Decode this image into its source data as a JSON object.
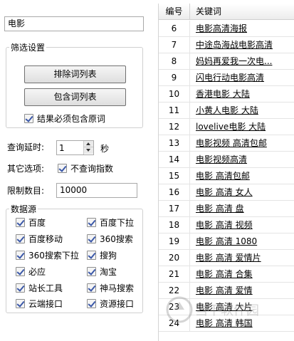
{
  "search": {
    "value": "电影"
  },
  "filter": {
    "legend": "筛选设置",
    "exclude_button": "排除词列表",
    "include_button": "包含词列表",
    "must_contain_label": "结果必须包含原词",
    "must_contain_checked": true
  },
  "query_delay": {
    "label": "查询延时:",
    "value": "1",
    "unit": "秒"
  },
  "other_options": {
    "label": "其它选项:",
    "no_index_label": "不查询指数",
    "no_index_checked": true
  },
  "limit": {
    "label": "限制数目:",
    "value": "10000"
  },
  "sources": {
    "legend": "数据源",
    "items": [
      {
        "label": "百度",
        "checked": true
      },
      {
        "label": "百度下拉",
        "checked": true
      },
      {
        "label": "百度移动",
        "checked": true
      },
      {
        "label": "360搜索",
        "checked": true
      },
      {
        "label": "360搜索下拉",
        "checked": true
      },
      {
        "label": "搜狗",
        "checked": true
      },
      {
        "label": "必应",
        "checked": true
      },
      {
        "label": "淘宝",
        "checked": true
      },
      {
        "label": "站长工具",
        "checked": true
      },
      {
        "label": "神马搜索",
        "checked": true
      },
      {
        "label": "云端接口",
        "checked": true
      },
      {
        "label": "资源接口",
        "checked": true
      }
    ]
  },
  "table": {
    "columns": [
      "编号",
      "关键词"
    ],
    "rows": [
      {
        "no": "6",
        "keyword": "电影高清海报"
      },
      {
        "no": "7",
        "keyword": "中途岛海战电影高清"
      },
      {
        "no": "8",
        "keyword": "妈妈再爱我一次电..."
      },
      {
        "no": "9",
        "keyword": "闪电行动电影高清"
      },
      {
        "no": "10",
        "keyword": "香港电影 大陆"
      },
      {
        "no": "11",
        "keyword": "小黄人电影 大陆"
      },
      {
        "no": "12",
        "keyword": "lovelive电影 大陆"
      },
      {
        "no": "13",
        "keyword": "电影视频 高清包邮"
      },
      {
        "no": "14",
        "keyword": "电影视频高清"
      },
      {
        "no": "15",
        "keyword": "电影 高清包邮"
      },
      {
        "no": "16",
        "keyword": "电影 高清 女人"
      },
      {
        "no": "17",
        "keyword": "电影 高清 盘"
      },
      {
        "no": "18",
        "keyword": "电影 高清 视频"
      },
      {
        "no": "19",
        "keyword": "电影 高清 1080"
      },
      {
        "no": "20",
        "keyword": "电影 高清 爱情片"
      },
      {
        "no": "21",
        "keyword": "电影 高清 合集"
      },
      {
        "no": "22",
        "keyword": "电影 高清 爱情"
      },
      {
        "no": "23",
        "keyword": "电影 高清 大片"
      },
      {
        "no": "24",
        "keyword": "电影 高清 韩国"
      }
    ]
  },
  "watermark": {
    "text": "当下软件园"
  }
}
